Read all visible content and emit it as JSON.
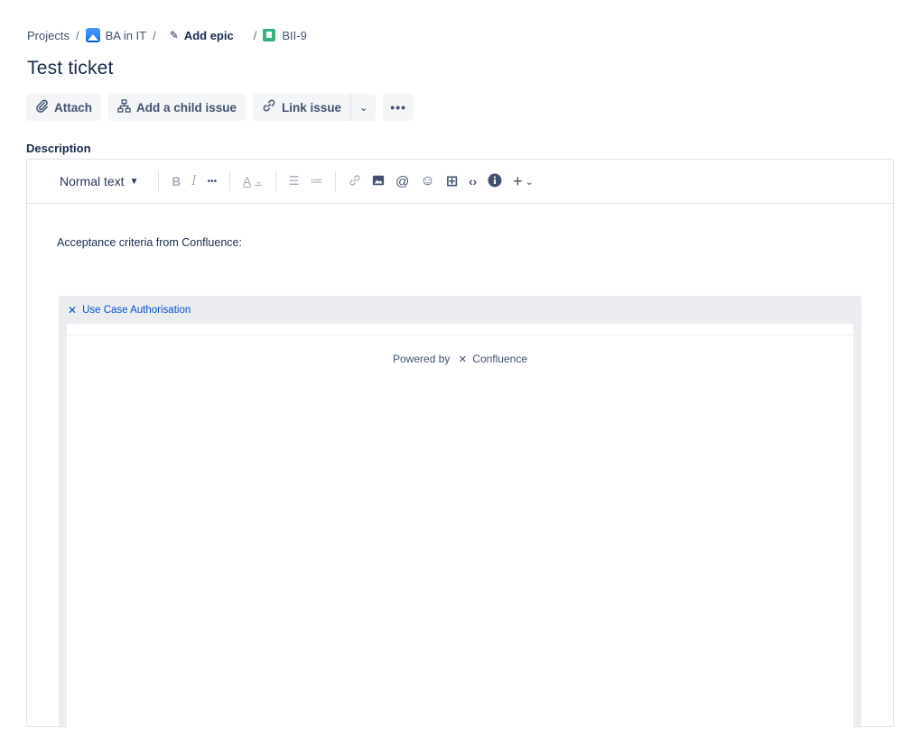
{
  "breadcrumb": {
    "projects": "Projects",
    "separator": "/",
    "project": "BA in IT",
    "epic": "Add epic",
    "issue_key": "BII-9"
  },
  "issue": {
    "title": "Test ticket"
  },
  "actions": {
    "attach": "Attach",
    "add_child": "Add a child issue",
    "link_issue": "Link issue",
    "more": "•••"
  },
  "description": {
    "label": "Description",
    "toolbar": {
      "text_style": "Normal text",
      "bold": "B",
      "italic": "I",
      "more": "•••",
      "color": "A",
      "bullet": "☰",
      "numbered": "≔",
      "link": "🔗",
      "image": "▣",
      "mention": "@",
      "emoji": "☺",
      "table": "⊞",
      "code": "‹›",
      "info": "i",
      "insert": "+"
    },
    "paragraph": "Acceptance criteria from Confluence:",
    "embed": {
      "page_title": "Use Case Authorisation",
      "powered_by": "Powered by",
      "product": "Confluence"
    }
  },
  "colors": {
    "link_blue": "#0052cc",
    "button_bg": "#f4f5f7",
    "text": "#172b4d",
    "embed_bg": "#ebecf0",
    "story_green": "#36b37e"
  },
  "icons": [
    "project-avatar-icon",
    "pencil-icon",
    "story-icon",
    "paperclip-icon",
    "hierarchy-icon",
    "link-icon",
    "chevron-down-icon",
    "more-icon",
    "confluence-icon"
  ]
}
